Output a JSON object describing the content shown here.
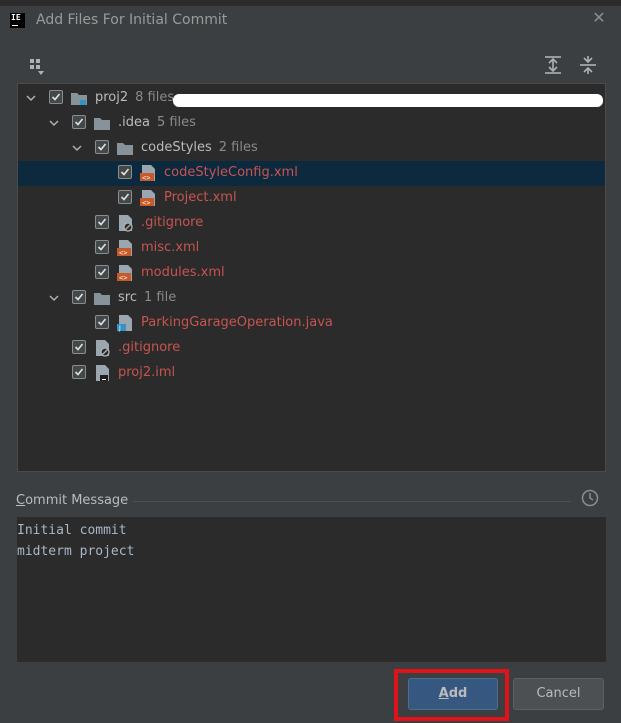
{
  "window": {
    "title": "Add Files For Initial Commit",
    "app_icon_text": "IE",
    "close_label": "✕"
  },
  "toolbar": {
    "group_icon": "group-by-icon",
    "expand_icon": "expand-all-icon",
    "collapse_icon": "collapse-all-icon"
  },
  "tree": [
    {
      "label": "proj2",
      "hint": "8 files",
      "depth": 0,
      "expanded": true,
      "checked": true,
      "icon": "module-folder-icon",
      "color": "normal"
    },
    {
      "label": ".idea",
      "hint": "5 files",
      "depth": 1,
      "expanded": true,
      "checked": true,
      "icon": "folder-icon",
      "color": "normal"
    },
    {
      "label": "codeStyles",
      "hint": "2 files",
      "depth": 2,
      "expanded": true,
      "checked": true,
      "icon": "folder-icon",
      "color": "normal"
    },
    {
      "label": "codeStyleConfig.xml",
      "hint": "",
      "depth": 3,
      "checked": true,
      "icon": "xml-file-icon",
      "color": "red",
      "selected": true
    },
    {
      "label": "Project.xml",
      "hint": "",
      "depth": 3,
      "checked": true,
      "icon": "xml-file-icon",
      "color": "red"
    },
    {
      "label": ".gitignore",
      "hint": "",
      "depth": 2,
      "checked": true,
      "icon": "ignore-file-icon",
      "color": "red"
    },
    {
      "label": "misc.xml",
      "hint": "",
      "depth": 2,
      "checked": true,
      "icon": "xml-file-icon",
      "color": "red"
    },
    {
      "label": "modules.xml",
      "hint": "",
      "depth": 2,
      "checked": true,
      "icon": "xml-file-icon",
      "color": "red"
    },
    {
      "label": "src",
      "hint": "1 file",
      "depth": 1,
      "expanded": true,
      "checked": true,
      "icon": "folder-icon",
      "color": "normal"
    },
    {
      "label": "ParkingGarageOperation.java",
      "hint": "",
      "depth": 2,
      "checked": true,
      "icon": "java-file-icon",
      "color": "red"
    },
    {
      "label": ".gitignore",
      "hint": "",
      "depth": 1,
      "checked": true,
      "icon": "ignore-file-icon",
      "color": "red"
    },
    {
      "label": "proj2.iml",
      "hint": "",
      "depth": 1,
      "checked": true,
      "icon": "iml-file-icon",
      "color": "red"
    }
  ],
  "commit": {
    "label_prefix": "C",
    "label_rest": "ommit Message",
    "history_icon": "history-icon",
    "message_lines": [
      "Initial commit",
      "midterm project"
    ]
  },
  "buttons": {
    "add_underlined": "A",
    "add_rest": "dd",
    "cancel": "Cancel"
  },
  "colors": {
    "unversioned": "#c75450",
    "selection": "#0d293e",
    "default_button": "#365880",
    "highlight": "#e0131a"
  }
}
